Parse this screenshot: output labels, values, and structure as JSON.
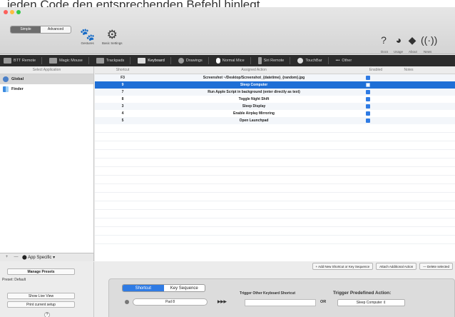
{
  "caption": "jeden Code den entsprechenden Befehl hinlegt",
  "toolbar": {
    "mode_simple": "Simple",
    "mode_advanced": "Advanced",
    "gestures_label": "Gestures",
    "basic_settings_label": "Basic Settings",
    "right": [
      {
        "label": "Docs",
        "icon": "help-icon"
      },
      {
        "label": "Usage",
        "icon": "pie-chart-icon"
      },
      {
        "label": "About",
        "icon": "tag-icon"
      },
      {
        "label": "News",
        "icon": "broadcast-icon"
      }
    ]
  },
  "tabs": [
    {
      "label": "BTT Remote",
      "icon": "remote-icon"
    },
    {
      "label": "Magic Mouse",
      "icon": "mouse-icon"
    },
    {
      "label": "Trackpads",
      "icon": "trackpad-icon"
    },
    {
      "label": "Keyboard",
      "icon": "keyboard-icon",
      "active": true
    },
    {
      "label": "Drawings",
      "icon": "drawing-icon"
    },
    {
      "label": "Normal Mice",
      "icon": "mouse-icon"
    },
    {
      "label": "Siri Remote",
      "icon": "siri-remote-icon"
    },
    {
      "label": "TouchBar",
      "icon": "touchbar-icon"
    },
    {
      "label": "Other",
      "icon": "more-icon"
    }
  ],
  "sidebar": {
    "header": "Select Application",
    "apps": [
      {
        "name": "Global",
        "selected": true
      },
      {
        "name": "Finder",
        "selected": false
      }
    ],
    "footer": {
      "add": "+",
      "remove": "—",
      "app_specific": "App Specific"
    }
  },
  "table": {
    "columns": [
      "Shortcut",
      "Assigned Action",
      "Enabled",
      "Notes"
    ],
    "rows": [
      {
        "shortcut": "F3",
        "action": "Screenshot ~/Desktop/Screenshot_{datetime}_{random}.jpg",
        "enabled": true
      },
      {
        "shortcut": "9",
        "action": "Sleep Computer",
        "enabled": true,
        "selected": true
      },
      {
        "shortcut": "7",
        "action": "Run Apple Script in background (enter directly as text)",
        "enabled": true
      },
      {
        "shortcut": "8",
        "action": "Toggle Night Shift",
        "enabled": true
      },
      {
        "shortcut": "3",
        "action": "Sleep Display",
        "enabled": true
      },
      {
        "shortcut": "4",
        "action": "Enable Airplay Mirroring",
        "enabled": true
      },
      {
        "shortcut": "5",
        "action": "Open Launchpad",
        "enabled": true
      }
    ]
  },
  "actions": {
    "add_new": "+ Add New Shortcut or Key Sequence",
    "attach": "Attach Additional Action",
    "delete": "— Delete selected"
  },
  "left_panel": {
    "manage_presets": "Manage Presets",
    "preset": "Preset: Default",
    "show_live_view": "Show Live View",
    "print_setup": "Print current setup",
    "help": "?"
  },
  "config": {
    "tab_shortcut": "Shortcut",
    "tab_key_sequence": "Key Sequence",
    "key_value": "Pad 8",
    "trigger_other": "Trigger Other Keyboard Shortcut",
    "arrows": "▶▶▶",
    "or": "OR",
    "trigger_predefined": "Trigger Predefined Action:",
    "predefined_value": "Sleep Computer"
  },
  "colors": {
    "selection": "#1f6fd6",
    "tabbar": "#2c2c2c",
    "checkbox": "#2f7be4"
  }
}
